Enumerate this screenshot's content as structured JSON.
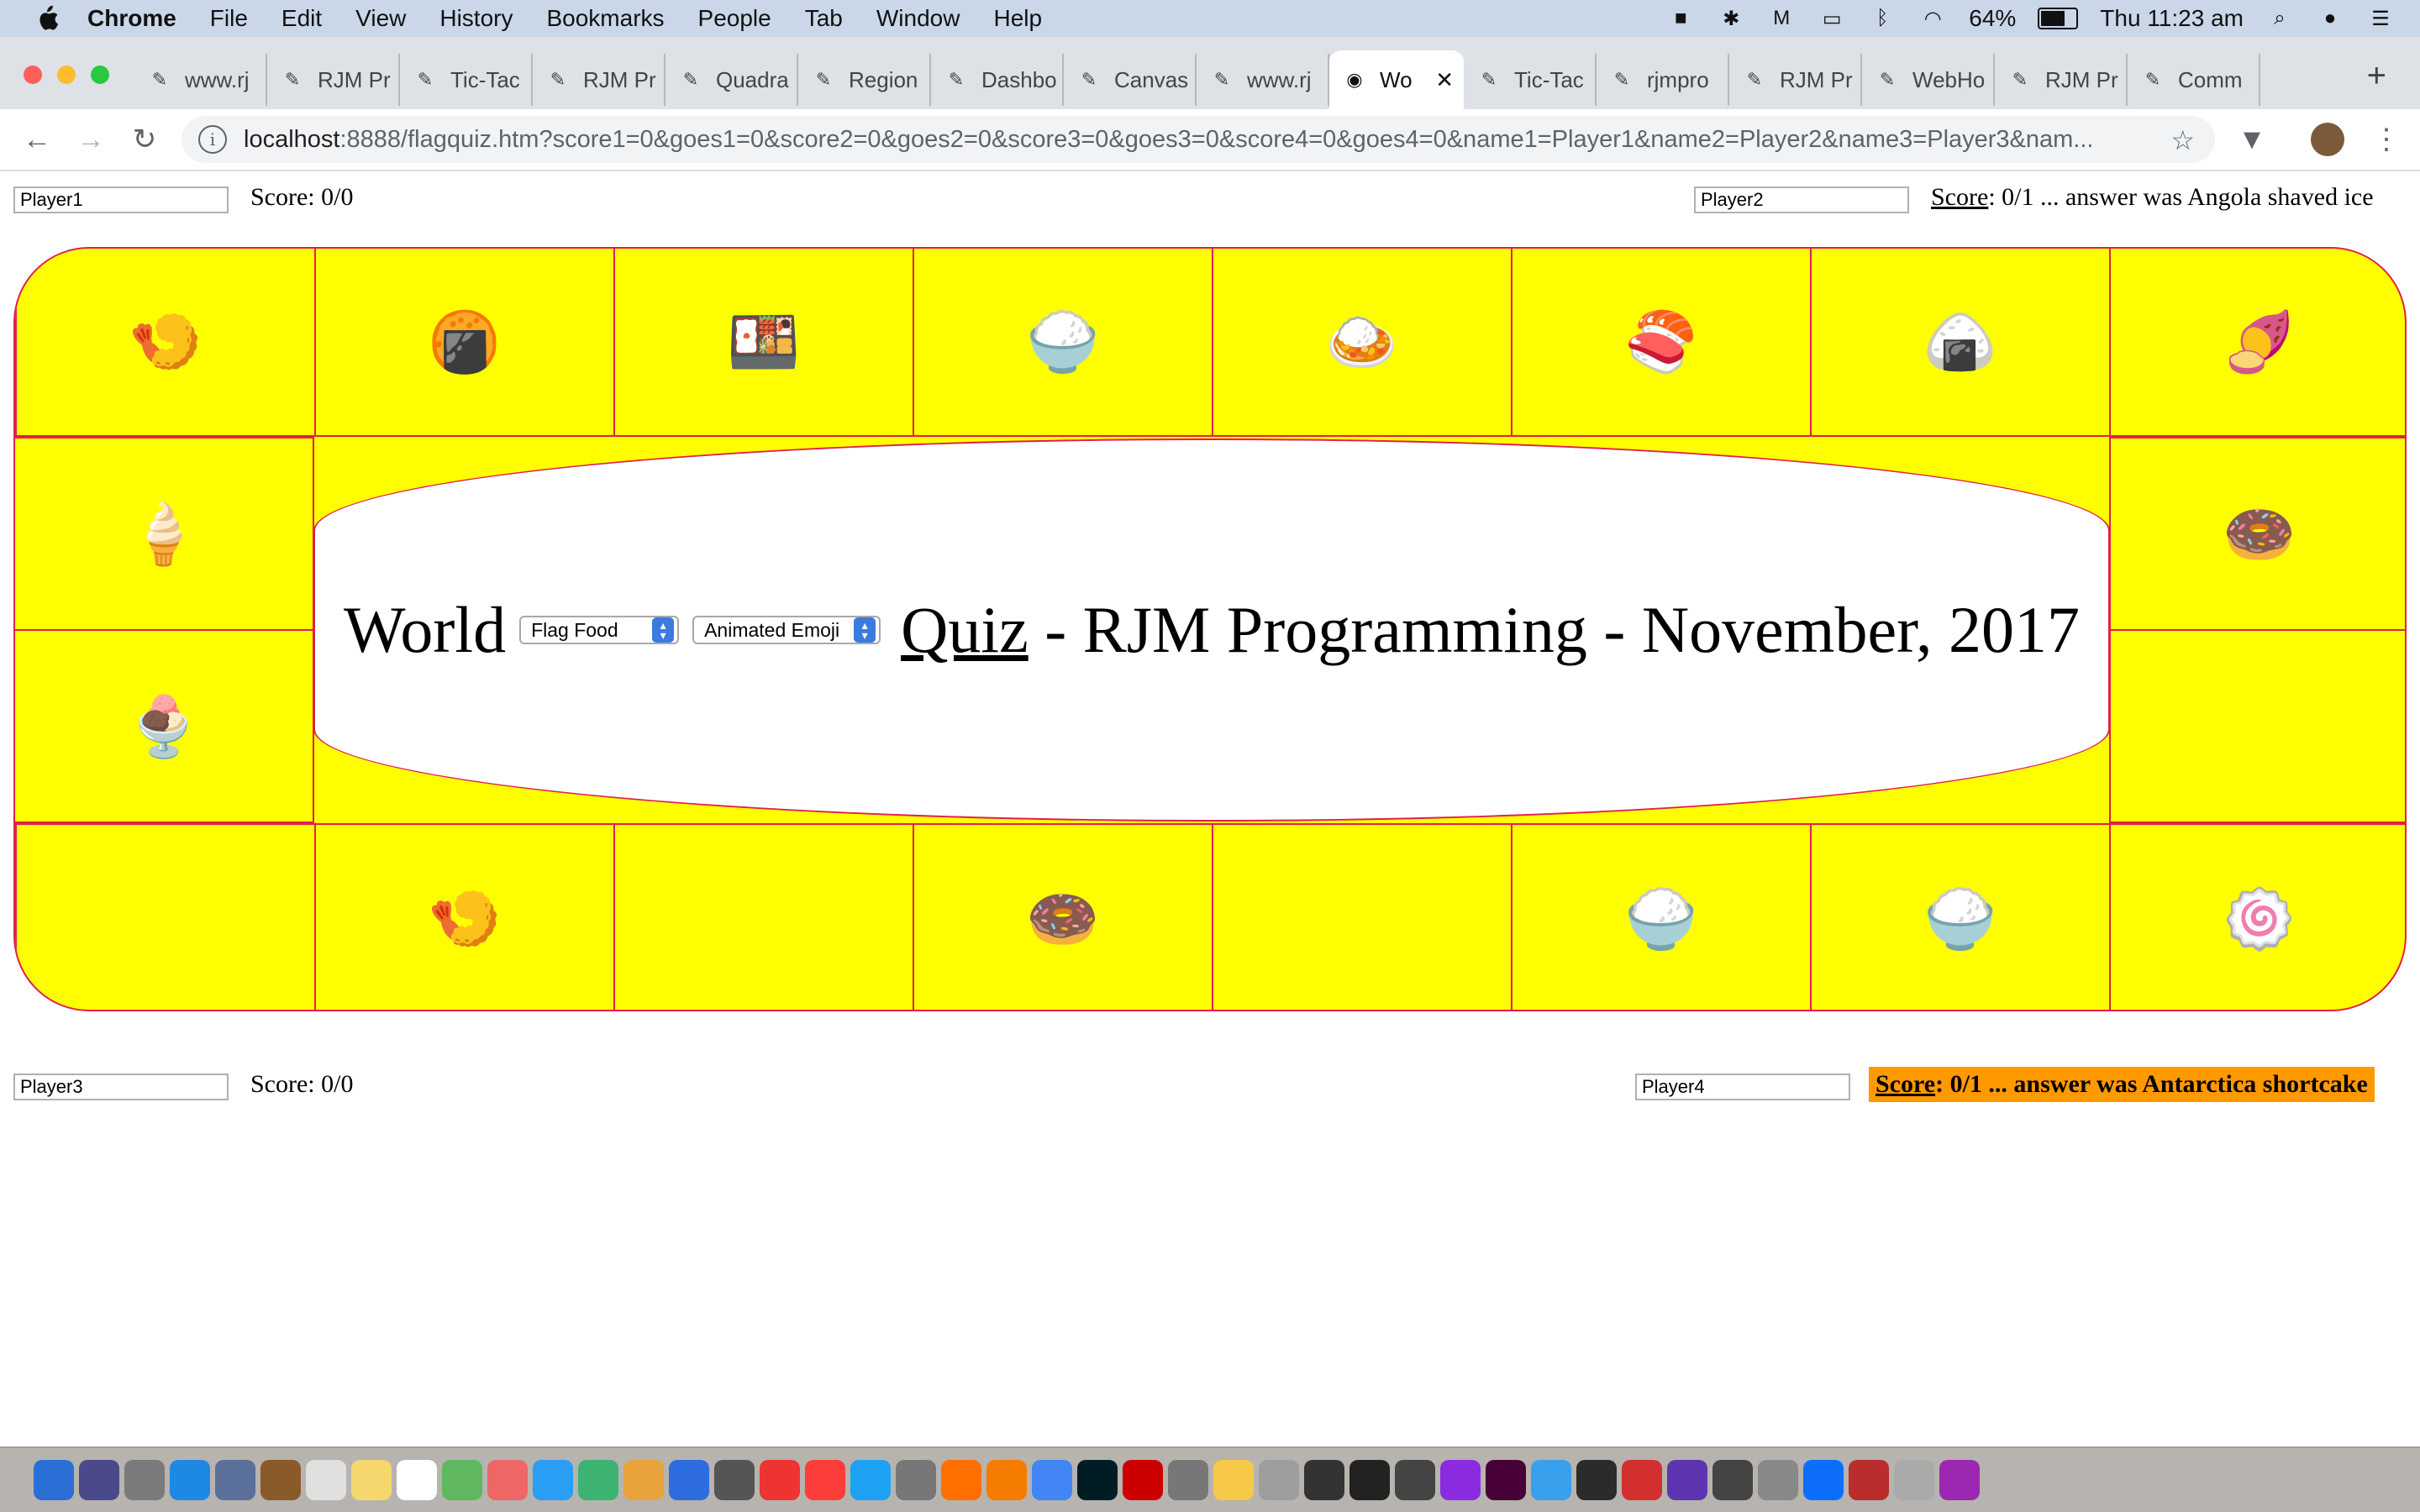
{
  "menubar": {
    "apple": "",
    "app": "Chrome",
    "items": [
      "File",
      "Edit",
      "View",
      "History",
      "Bookmarks",
      "People",
      "Tab",
      "Window",
      "Help"
    ],
    "battery": "64%",
    "clock": "Thu 11:23 am"
  },
  "tabs": [
    {
      "label": "www.rj",
      "active": false
    },
    {
      "label": "RJM Pr",
      "active": false
    },
    {
      "label": "Tic-Tac",
      "active": false
    },
    {
      "label": "RJM Pr",
      "active": false
    },
    {
      "label": "Quadra",
      "active": false
    },
    {
      "label": "Region",
      "active": false
    },
    {
      "label": "Dashbo",
      "active": false
    },
    {
      "label": "Canvas",
      "active": false
    },
    {
      "label": "www.rj",
      "active": false
    },
    {
      "label": "Wo",
      "active": true
    },
    {
      "label": "Tic-Tac",
      "active": false
    },
    {
      "label": "rjmpro",
      "active": false
    },
    {
      "label": "RJM Pr",
      "active": false
    },
    {
      "label": "WebHo",
      "active": false
    },
    {
      "label": "RJM Pr",
      "active": false
    },
    {
      "label": "Comm",
      "active": false
    }
  ],
  "omnibox": {
    "host": "localhost",
    "rest": ":8888/flagquiz.htm?score1=0&goes1=0&score2=0&goes2=0&score3=0&goes3=0&score4=0&goes4=0&name1=Player1&name2=Player2&name3=Player3&nam..."
  },
  "players": {
    "p1": {
      "name": "Player1",
      "score": "Score: 0/0"
    },
    "p2": {
      "name": "Player2",
      "score_label": "Score",
      "score": ": 0/1 ... answer was Angola shaved ice"
    },
    "p3": {
      "name": "Player3",
      "score": "Score: 0/0"
    },
    "p4": {
      "name": "Player4",
      "score_label": "Score",
      "score": ": 0/1 ... answer was Antarctica shortcake"
    }
  },
  "center": {
    "title_prefix": "World",
    "select1": "Flag Food",
    "select2": "Animated Emoji",
    "quiz_link": "Quiz",
    "title_suffix": " - RJM Programming - November, 2017"
  },
  "board": {
    "top": [
      "🍤",
      "🍘",
      "🍱",
      "🍚",
      "🍛",
      "🍣",
      "🍙",
      "🍠"
    ],
    "left": [
      "🍦",
      "🍨"
    ],
    "right": [
      "🍩",
      ""
    ],
    "bottom": [
      "",
      "🍤",
      "",
      "🍩",
      "",
      "🍚",
      "🍚",
      "🍥"
    ]
  },
  "colors": {
    "board": "#ffff00",
    "border": "#e0204a",
    "highlight": "#ff9900"
  }
}
